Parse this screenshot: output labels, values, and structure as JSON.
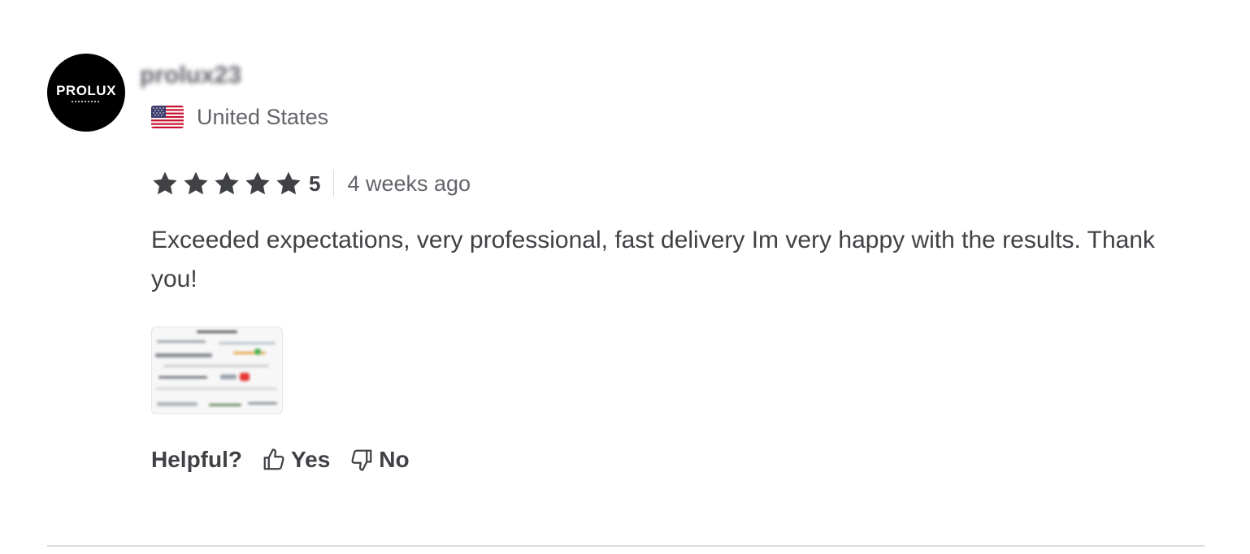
{
  "review": {
    "avatar_logo": "PROLUX",
    "username": "prolux23",
    "country": "United States",
    "rating": "5",
    "time_ago": "4 weeks ago",
    "text": "Exceeded expectations, very professional, fast delivery Im very happy with the results. Thank you!",
    "helpful_label": "Helpful?",
    "yes_label": "Yes",
    "no_label": "No"
  },
  "colors": {
    "star": "#404145",
    "text": "#404145",
    "muted": "#62646a",
    "divider": "#dadbdd"
  },
  "icons": [
    "star-icon",
    "us-flag-icon",
    "thumbs-up-icon",
    "thumbs-down-icon"
  ]
}
